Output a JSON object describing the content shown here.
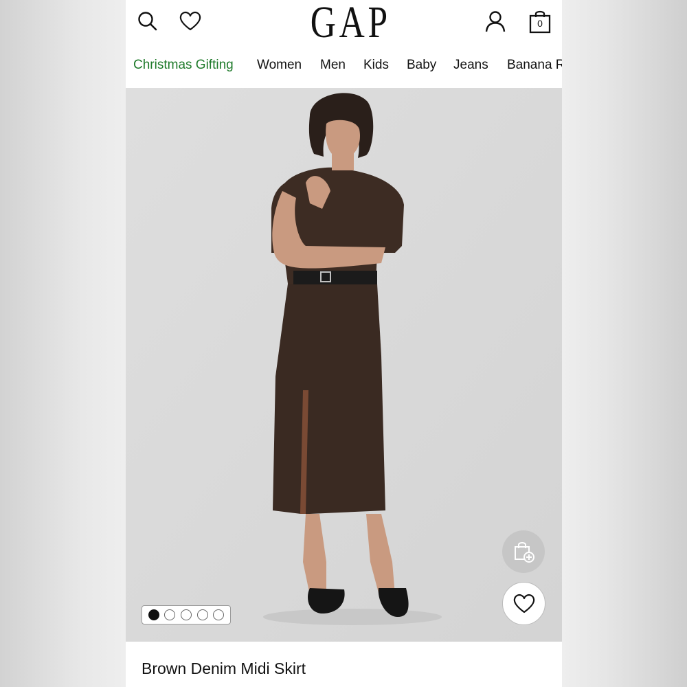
{
  "header": {
    "logo": "GAP",
    "bag_count": "0",
    "icons": {
      "search": "search-icon",
      "favorites": "heart-icon",
      "account": "user-icon",
      "bag": "shopping-bag-icon"
    }
  },
  "nav": {
    "items": [
      {
        "label": "Christmas Gifting",
        "highlight": true,
        "color": "#1e7a2a"
      },
      {
        "label": "Women"
      },
      {
        "label": "Men"
      },
      {
        "label": "Kids"
      },
      {
        "label": "Baby"
      },
      {
        "label": "Jeans"
      },
      {
        "label": "Banana Republic"
      }
    ]
  },
  "hero": {
    "image": "model-in-brown-denim-midi-skirt",
    "carousel": {
      "total": 5,
      "active": 1
    },
    "quick_add_icon": "bag-add-icon",
    "favorite_icon": "heart-icon"
  },
  "product": {
    "title": "Brown Denim Midi Skirt"
  }
}
